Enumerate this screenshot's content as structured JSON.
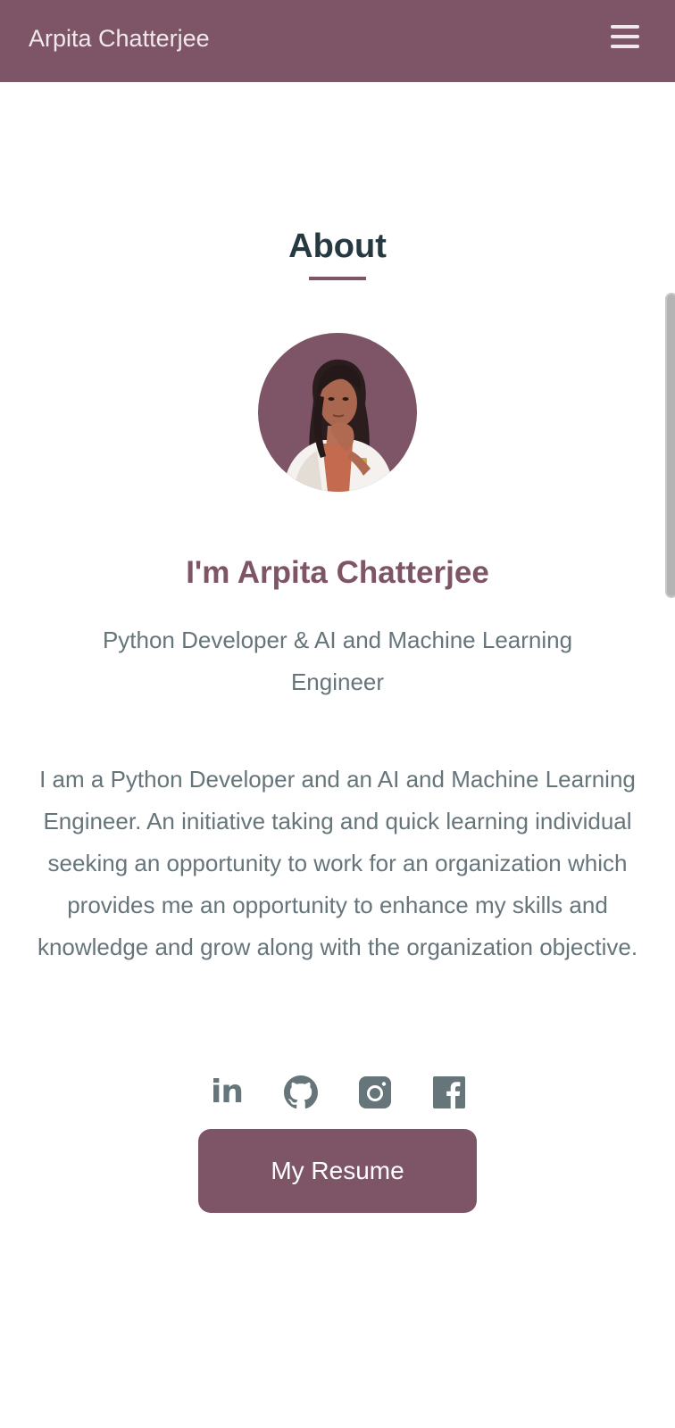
{
  "navbar": {
    "brand": "Arpita Chatterjee",
    "menu_icon": "hamburger-menu-icon",
    "background": "#7e5566"
  },
  "about": {
    "title": "About",
    "avatar_alt": "Arpita Chatterjee",
    "name": "I'm Arpita Chatterjee",
    "role": "Python Developer & AI and Machine Learning Engineer",
    "bio": "I am a Python Developer and an AI and Machine Learning Engineer. An initiative taking and quick learning individual seeking an opportunity to work for an organization which provides me an opportunity to enhance my skills and knowledge and grow along with the organization objective.",
    "accent": "#7e5566",
    "text_color": "#66757a"
  },
  "social": {
    "icons": [
      "linkedin-icon",
      "github-icon",
      "instagram-icon",
      "facebook-icon"
    ],
    "linkedin_text": "in"
  },
  "resume_button": {
    "label": "My Resume"
  }
}
